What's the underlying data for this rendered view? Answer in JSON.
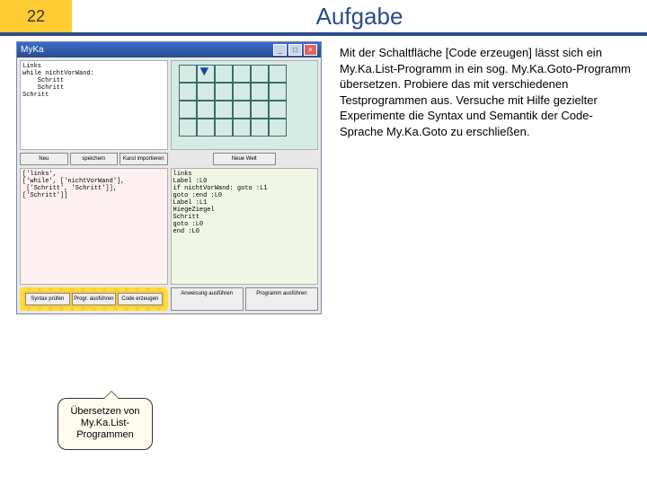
{
  "header": {
    "number": "22",
    "title": "Aufgabe"
  },
  "paragraph": "Mit der Schaltfläche [Code erzeugen] lässt sich ein My.Ka.List-Programm in ein sog. My.Ka.Goto-Programm übersetzen. Probiere das mit verschiedenen Testprogrammen aus. Versuche mit Hilfe gezielter Experimente die Syntax und Semantik der Code-Sprache My.Ka.Goto zu erschließen.",
  "app": {
    "title": "MyKa",
    "top_left_code": [
      "Links",
      "while nichtVorWand:",
      "    Schritt",
      "    Schritt",
      "Schritt"
    ],
    "bot_left_code": [
      "['links',",
      "['while', ['nichtVorWand'],",
      " ['Schritt', 'Schritt']],",
      "['Schritt']]"
    ],
    "bot_right_code": [
      "links",
      "Label :L0",
      "if nichtVorWand: goto :L1",
      "goto :end :L0",
      "Label :L1",
      "HiegeZiegel",
      "Schritt",
      "goto :L0",
      "end :L0"
    ],
    "buttons": {
      "tl": [
        "Neu",
        "speichern",
        "Karol importieren"
      ],
      "tr": [
        "Neue Welt"
      ],
      "bl": [
        "Syntax prüfen",
        "Progr. ausführen",
        "Code erzeugen"
      ],
      "br": [
        "Anweisung ausführen",
        "Programm ausführen"
      ]
    }
  },
  "callout": "Übersetzen von My.Ka.List-Programmen"
}
